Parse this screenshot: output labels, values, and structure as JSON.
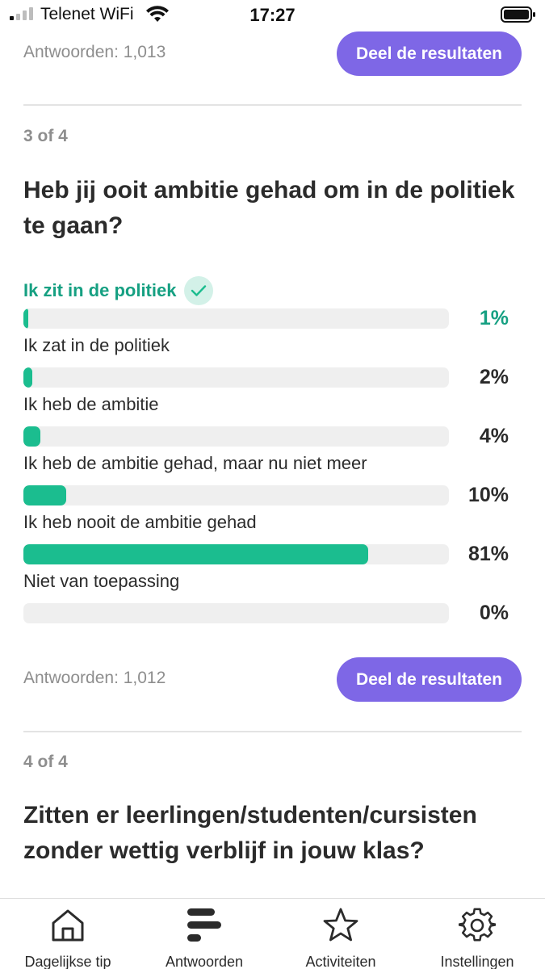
{
  "status_bar": {
    "carrier": "Telenet WiFi",
    "time": "17:27"
  },
  "top_block": {
    "answers_label": "Antwoorden: 1,013",
    "share_label": "Deel de resultaten"
  },
  "question3": {
    "index": "3 of 4",
    "title": "Heb jij ooit ambitie gehad om in de politiek te gaan?",
    "options": [
      {
        "label": "Ik zit in de politiek",
        "percent_text": "1%",
        "fill": 0.01,
        "selected": true
      },
      {
        "label": "Ik zat in de politiek",
        "percent_text": "2%",
        "fill": 0.02,
        "selected": false
      },
      {
        "label": "Ik heb de ambitie",
        "percent_text": "4%",
        "fill": 0.04,
        "selected": false
      },
      {
        "label": "Ik heb de ambitie gehad, maar nu niet meer",
        "percent_text": "10%",
        "fill": 0.1,
        "selected": false
      },
      {
        "label": "Ik heb nooit de ambitie gehad",
        "percent_text": "81%",
        "fill": 0.81,
        "selected": false
      },
      {
        "label": "Niet van toepassing",
        "percent_text": "0%",
        "fill": 0.0,
        "selected": false
      }
    ],
    "answers_label": "Antwoorden: 1,012",
    "share_label": "Deel de resultaten"
  },
  "question4": {
    "index": "4 of 4",
    "title": "Zitten er leerlingen/studenten/cursisten zonder wettig verblijf in jouw klas?"
  },
  "tabbar": {
    "tabs": [
      {
        "label": "Dagelijkse tip",
        "icon": "home-icon"
      },
      {
        "label": "Antwoorden",
        "icon": "answers-bars-icon"
      },
      {
        "label": "Activiteiten",
        "icon": "star-icon"
      },
      {
        "label": "Instellingen",
        "icon": "gear-icon"
      }
    ]
  },
  "colors": {
    "accent_purple": "#7e67e6",
    "accent_green": "#1bbd8f",
    "selected_text": "#16a082"
  }
}
